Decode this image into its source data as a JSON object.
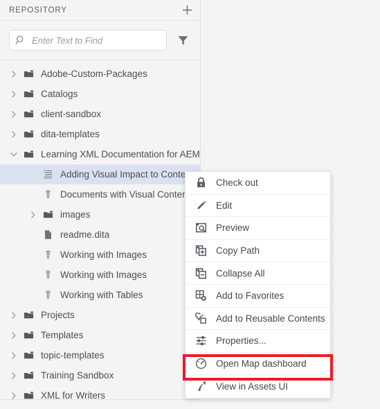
{
  "panel": {
    "title": "REPOSITORY",
    "add_icon": "plus-icon",
    "search": {
      "placeholder": "Enter Text to Find",
      "value": "",
      "icon": "search-icon"
    },
    "filter_icon": "filter-icon"
  },
  "tree": {
    "items": [
      {
        "label": "Adobe-Custom-Packages",
        "icon": "folder-icon",
        "twisty": "chevron-right-icon",
        "depth": 0,
        "selected": false
      },
      {
        "label": "Catalogs",
        "icon": "folder-icon",
        "twisty": "chevron-right-icon",
        "depth": 0,
        "selected": false
      },
      {
        "label": "client-sandbox",
        "icon": "folder-icon",
        "twisty": "chevron-right-icon",
        "depth": 0,
        "selected": false
      },
      {
        "label": "dita-templates",
        "icon": "folder-icon",
        "twisty": "chevron-right-icon",
        "depth": 0,
        "selected": false
      },
      {
        "label": "Learning XML Documentation for AEM",
        "icon": "folder-icon",
        "twisty": "chevron-down-icon",
        "depth": 0,
        "selected": false
      },
      {
        "label": "Adding Visual Impact to Content",
        "icon": "ditamap-icon",
        "twisty": "none",
        "depth": 1,
        "selected": true
      },
      {
        "label": "Documents with Visual Content",
        "icon": "topic-icon",
        "twisty": "none",
        "depth": 1,
        "selected": false
      },
      {
        "label": "images",
        "icon": "folder-icon",
        "twisty": "chevron-right-icon",
        "depth": 1,
        "selected": false
      },
      {
        "label": "readme.dita",
        "icon": "file-icon",
        "twisty": "none",
        "depth": 1,
        "selected": false
      },
      {
        "label": "Working with Images",
        "icon": "topic-icon",
        "twisty": "none",
        "depth": 1,
        "selected": false
      },
      {
        "label": "Working with Images",
        "icon": "topic-icon",
        "twisty": "none",
        "depth": 1,
        "selected": false
      },
      {
        "label": "Working with Tables",
        "icon": "topic-icon",
        "twisty": "none",
        "depth": 1,
        "selected": false
      },
      {
        "label": "Projects",
        "icon": "folder-icon",
        "twisty": "chevron-right-icon",
        "depth": 0,
        "selected": false
      },
      {
        "label": "Templates",
        "icon": "folder-icon",
        "twisty": "chevron-right-icon",
        "depth": 0,
        "selected": false
      },
      {
        "label": "topic-templates",
        "icon": "folder-icon",
        "twisty": "chevron-right-icon",
        "depth": 0,
        "selected": false
      },
      {
        "label": "Training Sandbox",
        "icon": "folder-icon",
        "twisty": "chevron-right-icon",
        "depth": 0,
        "selected": false
      },
      {
        "label": "XML for Writers",
        "icon": "folder-icon",
        "twisty": "chevron-right-icon",
        "depth": 0,
        "selected": false
      }
    ]
  },
  "context_menu": {
    "items": [
      {
        "label": "Check out",
        "icon": "lock-icon",
        "highlighted": false
      },
      {
        "label": "Edit",
        "icon": "pencil-icon",
        "highlighted": false
      },
      {
        "label": "Preview",
        "icon": "preview-icon",
        "highlighted": false
      },
      {
        "label": "Copy Path",
        "icon": "copy-path-icon",
        "highlighted": false
      },
      {
        "label": "Collapse All",
        "icon": "collapse-all-icon",
        "highlighted": false
      },
      {
        "label": "Add to Favorites",
        "icon": "add-to-favorites-icon",
        "highlighted": false
      },
      {
        "label": "Add to Reusable Contents",
        "icon": "add-reusable-icon",
        "highlighted": false
      },
      {
        "label": "Properties...",
        "icon": "properties-icon",
        "highlighted": false
      },
      {
        "label": "Open Map dashboard",
        "icon": "gauge-icon",
        "highlighted": true
      },
      {
        "label": "View in Assets UI",
        "icon": "external-arrow-icon",
        "highlighted": false
      }
    ]
  },
  "colors": {
    "highlight_red": "#ec1c24",
    "selection_blue": "#dbe2ef",
    "panel_bg": "#f4f4f4",
    "text": "#4a4f57"
  }
}
